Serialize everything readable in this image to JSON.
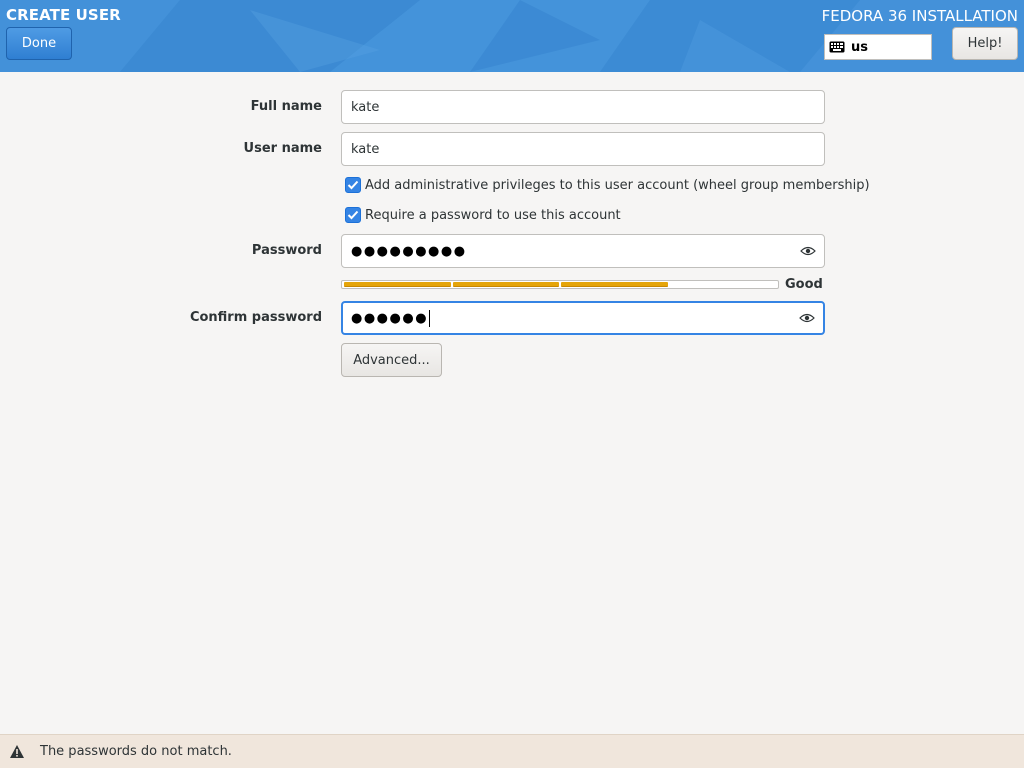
{
  "header": {
    "spoke_title": "CREATE USER",
    "done_label": "Done",
    "product_title": "FEDORA 36 INSTALLATION",
    "keyboard_layout": "us",
    "help_label": "Help!",
    "keyboard_icon": "keyboard-icon",
    "background_color": "#3f8fd6"
  },
  "form": {
    "full_name_label": "Full name",
    "full_name_value": "kate",
    "user_name_label": "User name",
    "user_name_value": "kate",
    "admin_checkbox_label": "Add administrative privileges to this user account (wheel group membership)",
    "admin_checked": true,
    "require_password_label": "Require a password to use this account",
    "require_password_checked": true,
    "password_label": "Password",
    "password_value": "●●●●●●●●●",
    "strength": {
      "label": "Good",
      "level": 3,
      "segments": 4,
      "filled_color": "#e5a50a",
      "empty_color": "#ffffff"
    },
    "confirm_label": "Confirm password",
    "confirm_value": "●●●●●●",
    "advanced_label": "Advanced...",
    "eye_icon": "eye-icon"
  },
  "status": {
    "message": "The passwords do not match.",
    "icon": "warning-icon"
  },
  "colors": {
    "accent": "#3584e4",
    "status_bg": "#f0e6dc"
  }
}
